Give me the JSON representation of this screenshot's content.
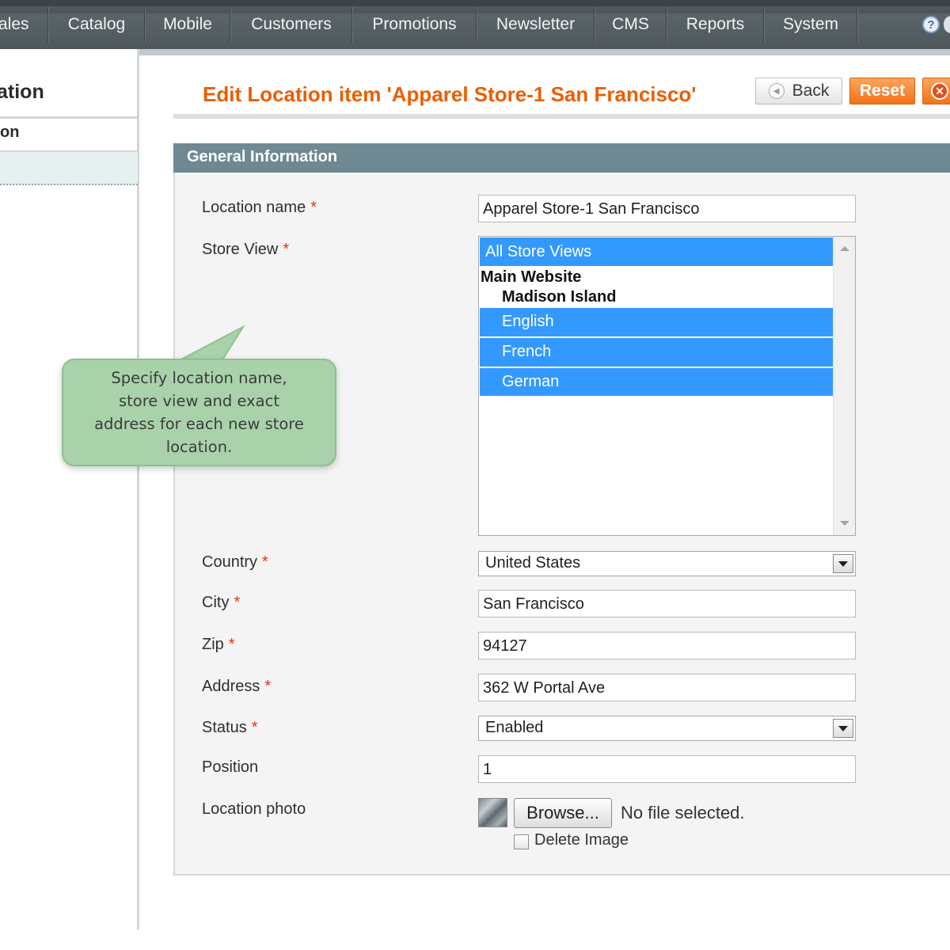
{
  "topnav": {
    "items": [
      "ales",
      "Catalog",
      "Mobile",
      "Customers",
      "Promotions",
      "Newsletter",
      "CMS",
      "Reports",
      "System"
    ]
  },
  "sidebar": {
    "title": "ation",
    "tab_label": "on"
  },
  "page": {
    "title": "Edit Location item 'Apparel Store-1 San Francisco'",
    "back_label": "Back",
    "reset_label": "Reset"
  },
  "section": {
    "title": "General Information"
  },
  "form": {
    "location_name": {
      "label": "Location name",
      "required": "*",
      "value": "Apparel Store-1 San Francisco"
    },
    "store_view": {
      "label": "Store View",
      "required": "*",
      "options": {
        "all": "All Store Views",
        "website": "Main Website",
        "store": "Madison Island",
        "english": "English",
        "french": "French",
        "german": "German"
      }
    },
    "country": {
      "label": "Country",
      "required": "*",
      "value": "United States"
    },
    "city": {
      "label": "City",
      "required": "*",
      "value": "San Francisco"
    },
    "zip": {
      "label": "Zip",
      "required": "*",
      "value": "94127"
    },
    "address": {
      "label": "Address",
      "required": "*",
      "value": "362 W Portal Ave"
    },
    "status": {
      "label": "Status",
      "required": "*",
      "value": "Enabled"
    },
    "position": {
      "label": "Position",
      "value": "1"
    },
    "photo": {
      "label": "Location photo",
      "browse_label": "Browse...",
      "file_status": "No file selected.",
      "delete_label": "Delete Image"
    }
  },
  "callout": {
    "text": "Specify location name, store view and exact address for each new store location."
  },
  "colors": {
    "title_orange": "#eb5e00",
    "section_header": "#6f8992",
    "selected_option": "#3399ff",
    "reset_button": "#f2731a",
    "required_star": "#eb340a",
    "callout_green": "#a9d2ab"
  },
  "icons": [
    "help-icon",
    "back-arrow-icon",
    "delete-icon",
    "select-arrow-icon",
    "scroll-up-icon",
    "scroll-down-icon",
    "photo-thumbnail"
  ]
}
